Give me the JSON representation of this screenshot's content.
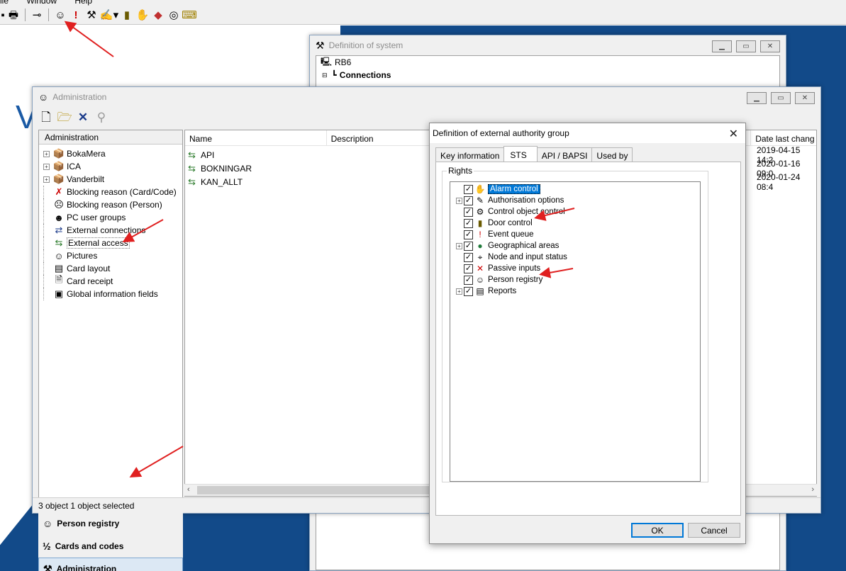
{
  "menu": {
    "items": [
      "ile",
      "Window",
      "Help"
    ]
  },
  "toolbar": {
    "icons": [
      "save-icon",
      "print-icon",
      "key-icon",
      "person-registry-icon",
      "alert-icon",
      "tools-icon",
      "cards-icon",
      "door-icon",
      "hand-icon",
      "object-icon",
      "globe-icon",
      "keyboard-icon"
    ]
  },
  "background": {
    "letter": "V"
  },
  "system_window": {
    "title": "Definition of system",
    "tree": [
      {
        "label": "RB6",
        "icon": "computer-icon"
      },
      {
        "label": "Connections",
        "icon": "connections-icon",
        "bold": true
      }
    ]
  },
  "admin_window": {
    "title": "Administration",
    "left_header": "Administration",
    "tree": [
      {
        "label": "BokaMera",
        "expandable": true,
        "icon": "folder-icon"
      },
      {
        "label": "ICA",
        "expandable": true,
        "icon": "folder-icon"
      },
      {
        "label": "Vanderbilt",
        "expandable": true,
        "icon": "folder-icon"
      },
      {
        "label": "Blocking reason (Card/Code)",
        "expandable": false,
        "icon": "blocked-card-icon"
      },
      {
        "label": "Blocking reason (Person)",
        "expandable": false,
        "icon": "blocked-person-icon"
      },
      {
        "label": "PC user groups",
        "expandable": false,
        "icon": "user-group-icon"
      },
      {
        "label": "External connections",
        "expandable": false,
        "icon": "external-connection-icon"
      },
      {
        "label": "External access",
        "expandable": false,
        "icon": "external-access-icon",
        "selected": true
      },
      {
        "label": "Pictures",
        "expandable": false,
        "icon": "pictures-icon"
      },
      {
        "label": "Card layout",
        "expandable": false,
        "icon": "card-layout-icon"
      },
      {
        "label": "Card receipt",
        "expandable": false,
        "icon": "card-receipt-icon"
      },
      {
        "label": "Global information fields",
        "expandable": false,
        "icon": "info-fields-icon"
      }
    ],
    "nav": [
      {
        "label": "Person registry",
        "icon": "person-registry-icon"
      },
      {
        "label": "Cards and codes",
        "icon": "cards-codes-icon"
      },
      {
        "label": "Administration",
        "icon": "administration-icon",
        "active": true
      }
    ],
    "columns": [
      "Name",
      "Description",
      "Date last chang"
    ],
    "rows": [
      {
        "name": "API",
        "date": "2019-04-15 14:2"
      },
      {
        "name": "BOKNINGAR",
        "date": "2020-01-16 09:0"
      },
      {
        "name": "KAN_ALLT",
        "date": "2020-01-24 08:4"
      }
    ],
    "status": "3 object 1 object selected"
  },
  "dialog": {
    "title": "Definition of external authority group",
    "tabs": [
      "Key information",
      "STS",
      "API / BAPSI",
      "Used by"
    ],
    "active_tab": "STS",
    "group_label": "Rights",
    "rights": [
      {
        "label": "Alarm control",
        "expandable": false,
        "checked": true,
        "selected": true,
        "icon": "hand-icon"
      },
      {
        "label": "Authorisation options",
        "expandable": true,
        "checked": true,
        "icon": "authorisation-icon"
      },
      {
        "label": "Control object control",
        "expandable": false,
        "checked": true,
        "icon": "control-object-icon"
      },
      {
        "label": "Door control",
        "expandable": false,
        "checked": true,
        "icon": "door-icon"
      },
      {
        "label": "Event queue",
        "expandable": false,
        "checked": true,
        "icon": "alert-icon"
      },
      {
        "label": "Geographical areas",
        "expandable": true,
        "checked": true,
        "icon": "globe-icon"
      },
      {
        "label": "Node and input status",
        "expandable": false,
        "checked": true,
        "icon": "node-icon"
      },
      {
        "label": "Passive inputs",
        "expandable": false,
        "checked": true,
        "icon": "passive-inputs-icon"
      },
      {
        "label": "Person registry",
        "expandable": false,
        "checked": true,
        "icon": "person-registry-icon"
      },
      {
        "label": "Reports",
        "expandable": true,
        "checked": true,
        "icon": "reports-icon"
      }
    ],
    "ok_label": "OK",
    "cancel_label": "Cancel"
  },
  "colors": {
    "background_blue": "#124a89",
    "selection_blue": "#0078d7",
    "annotation_red": "#e02020"
  }
}
